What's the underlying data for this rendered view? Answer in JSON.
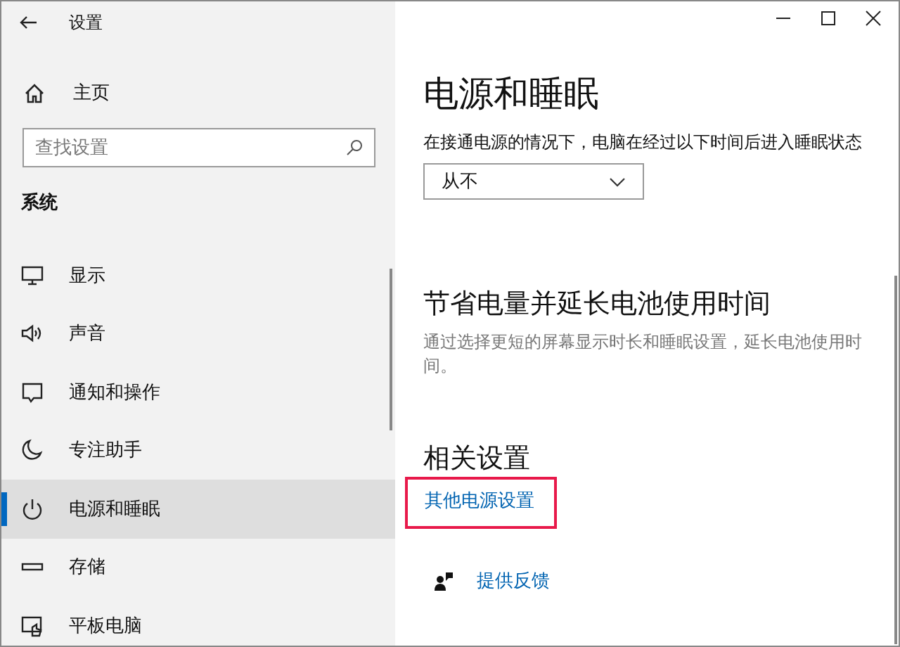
{
  "window": {
    "title": "设置"
  },
  "sidebar": {
    "home": "主页",
    "search": {
      "placeholder": "查找设置"
    },
    "section": "系统",
    "items": [
      {
        "label": "显示",
        "selected": false
      },
      {
        "label": "声音",
        "selected": false
      },
      {
        "label": "通知和操作",
        "selected": false
      },
      {
        "label": "专注助手",
        "selected": false
      },
      {
        "label": "电源和睡眠",
        "selected": true
      },
      {
        "label": "存储",
        "selected": false
      },
      {
        "label": "平板电脑",
        "selected": false
      }
    ]
  },
  "content": {
    "title": "电源和睡眠",
    "sleep_label": "在接通电源的情况下，电脑在经过以下时间后进入睡眠状态",
    "sleep_dropdown": {
      "value": "从不"
    },
    "battery_heading": "节省电量并延长电池使用时间",
    "battery_text": "通过选择更短的屏幕显示时长和睡眠设置，延长电池使用时间。",
    "related_heading": "相关设置",
    "related_link": {
      "label": "其他电源设置",
      "highlighted": true
    },
    "feedback_link": "提供反馈"
  }
}
